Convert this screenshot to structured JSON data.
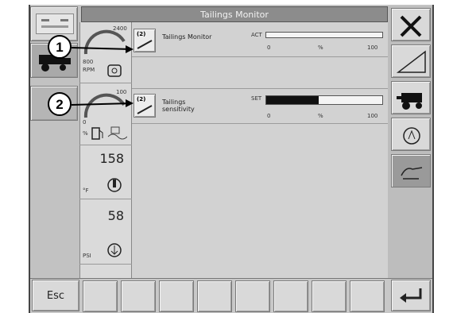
{
  "header": {
    "title": "Tailings Monitor"
  },
  "gauges": [
    {
      "max": "2400",
      "low": "800",
      "unit": "RPM"
    },
    {
      "max": "100",
      "low": "0",
      "unit": "%"
    }
  ],
  "readouts": [
    {
      "value": "158",
      "unit": "°F"
    },
    {
      "value": "58",
      "unit": "PSI"
    }
  ],
  "rows": [
    {
      "badge": "(2)",
      "label": "Tailings Monitor",
      "bar_tag": "ACT",
      "scale_min": "0",
      "scale_unit": "%",
      "scale_max": "100",
      "fill": 0.0
    },
    {
      "badge": "(2)",
      "label": "Tailings sensitivity",
      "bar_tag": "SET",
      "scale_min": "0",
      "scale_unit": "%",
      "scale_max": "100",
      "fill": 0.45
    }
  ],
  "callouts": [
    "1",
    "2"
  ],
  "bottom": {
    "esc_label": "Esc"
  },
  "icons": [
    "auto-icon",
    "combine-icon",
    "tools-icon",
    "slope-icon",
    "combine-side-icon",
    "engine-icon",
    "hand-icon",
    "enter-icon",
    "fuel-icon",
    "temperature-icon",
    "oil-pressure-icon"
  ]
}
